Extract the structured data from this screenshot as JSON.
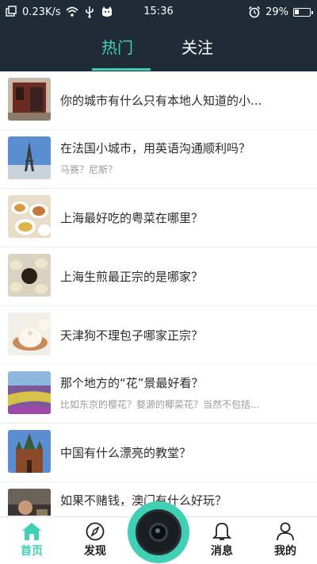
{
  "status_bar": {
    "speed": "0.23K/s",
    "time": "15:36",
    "battery_percent": "29%",
    "battery_level": 0.29,
    "icons": [
      "notification-icon",
      "wifi-icon",
      "usb-icon",
      "cat-icon",
      "alarm-icon",
      "battery-icon"
    ]
  },
  "header": {
    "tabs": [
      {
        "label": "热门",
        "active": true
      },
      {
        "label": "关注",
        "active": false
      }
    ],
    "accent_color": "#3fd0b6",
    "background_color": "#1f2b36"
  },
  "feed": {
    "items": [
      {
        "title": "你的城市有什么只有本地人知道的小...",
        "subtitle": "",
        "thumb": "building-photo"
      },
      {
        "title": "在法国小城市，用英语沟通顺利吗？",
        "subtitle": "马赛？尼斯？",
        "thumb": "eiffel-tower-photo"
      },
      {
        "title": "上海最好吃的粤菜在哪里？",
        "subtitle": "",
        "thumb": "dim-sum-photo"
      },
      {
        "title": "上海生煎最正宗的是哪家？",
        "subtitle": "",
        "thumb": "dumplings-photo"
      },
      {
        "title": "天津狗不理包子哪家正宗？",
        "subtitle": "",
        "thumb": "baozi-photo"
      },
      {
        "title": "那个地方的“花”景最好看？",
        "subtitle": "比如东京的樱花？婺源的椰菜花？当然不包括...",
        "thumb": "flower-field-photo"
      },
      {
        "title": "中国有什么漂亮的教堂？",
        "subtitle": "",
        "thumb": "church-photo"
      },
      {
        "title": "如果不赌钱，澳门有什么好玩？",
        "subtitle": "",
        "thumb": "macau-photo"
      }
    ]
  },
  "bottom_nav": {
    "items": [
      {
        "label": "首页",
        "icon": "home-icon",
        "active": true
      },
      {
        "label": "发现",
        "icon": "compass-icon",
        "active": false
      },
      {
        "label": "",
        "icon": "camera-icon",
        "active": false
      },
      {
        "label": "消息",
        "icon": "bell-icon",
        "active": false
      },
      {
        "label": "我的",
        "icon": "user-icon",
        "active": false
      }
    ]
  }
}
